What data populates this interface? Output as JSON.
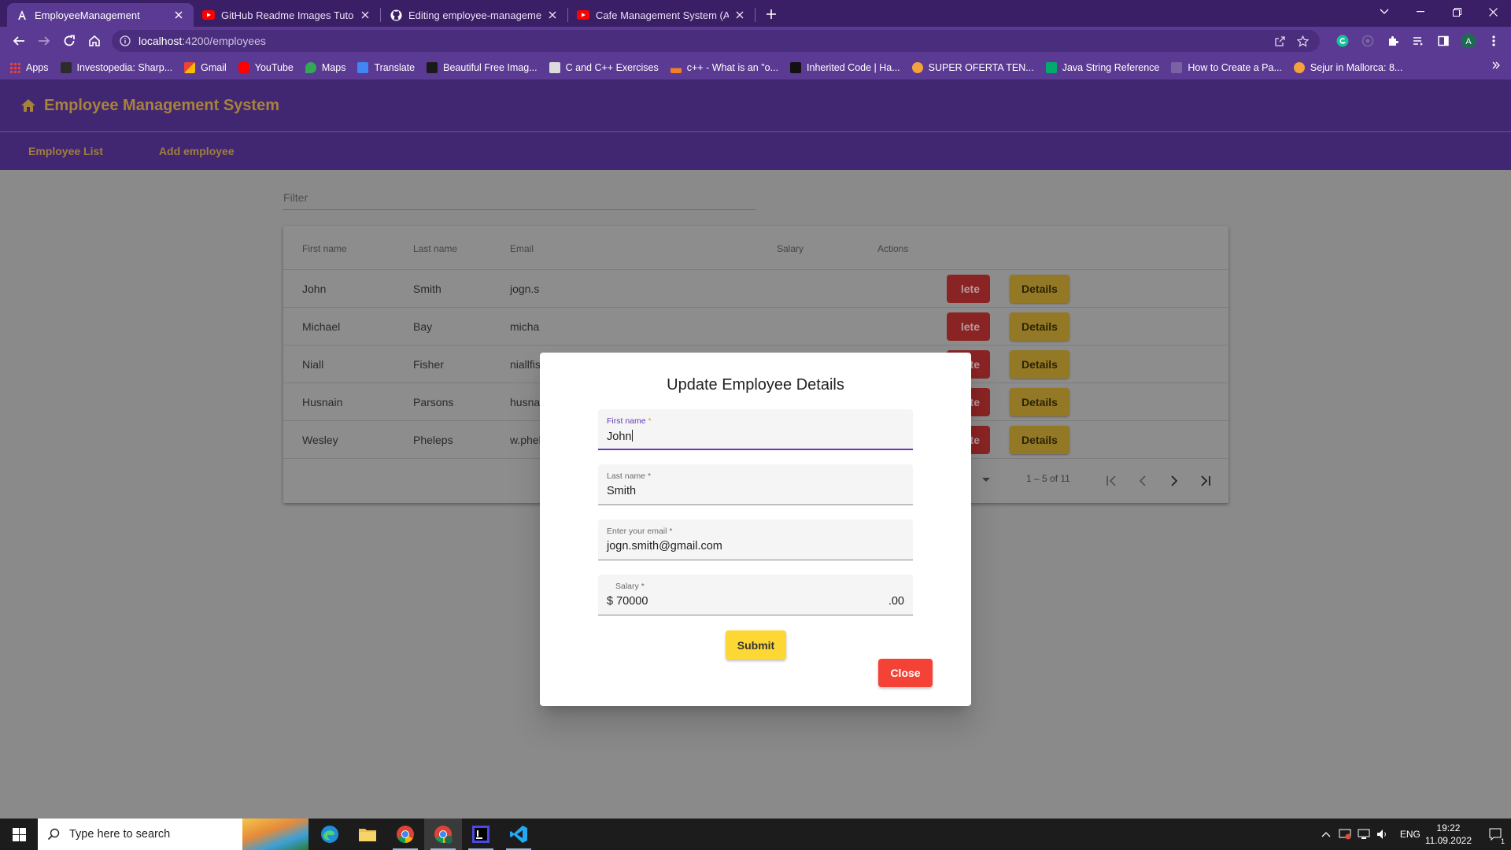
{
  "browser": {
    "tabs": [
      {
        "title": "EmployeeManagement",
        "favicon": "angular-icon",
        "active": true
      },
      {
        "title": "GitHub Readme Images Tutorial",
        "favicon": "youtube-icon",
        "active": false
      },
      {
        "title": "Editing employee-management-",
        "favicon": "github-icon",
        "active": false
      },
      {
        "title": "Cafe Management System (Angu",
        "favicon": "youtube-icon",
        "active": false
      }
    ],
    "url_host": "localhost",
    "url_path": ":4200/employees",
    "bookmarks": [
      {
        "label": "Apps",
        "icon": "apps-grid-icon"
      },
      {
        "label": "Investopedia: Sharp...",
        "icon": "investopedia-icon"
      },
      {
        "label": "Gmail",
        "icon": "gmail-icon"
      },
      {
        "label": "YouTube",
        "icon": "youtube-icon"
      },
      {
        "label": "Maps",
        "icon": "maps-icon"
      },
      {
        "label": "Translate",
        "icon": "translate-icon"
      },
      {
        "label": "Beautiful Free Imag...",
        "icon": "unsplash-icon"
      },
      {
        "label": "C and C++ Exercises",
        "icon": "exercises-icon"
      },
      {
        "label": "c++ - What is an \"o...",
        "icon": "stackoverflow-icon"
      },
      {
        "label": "Inherited Code | Ha...",
        "icon": "hackerrank-icon"
      },
      {
        "label": "SUPER OFERTA TEN...",
        "icon": "offer-icon"
      },
      {
        "label": "Java String Reference",
        "icon": "w3schools-icon"
      },
      {
        "label": "How to Create a Pa...",
        "icon": "page-icon"
      },
      {
        "label": "Sejur in Mallorca: 8...",
        "icon": "travel-icon"
      }
    ]
  },
  "app": {
    "title": "Employee Management System",
    "nav": [
      "Employee List",
      "Add employee"
    ],
    "filter_placeholder": "Filter",
    "table": {
      "headers": [
        "First name",
        "Last name",
        "Email",
        "Salary",
        "Actions"
      ],
      "rows": [
        {
          "first": "John",
          "last": "Smith",
          "email": "jogn.s"
        },
        {
          "first": "Michael",
          "last": "Bay",
          "email": "micha"
        },
        {
          "first": "Niall",
          "last": "Fisher",
          "email": "niallfis"
        },
        {
          "first": "Husnain",
          "last": "Parsons",
          "email": "husna"
        },
        {
          "first": "Wesley",
          "last": "Pheleps",
          "email": "w.phel"
        }
      ],
      "delete_label": "lete",
      "details_label": "Details"
    },
    "paginator": {
      "range": "1 – 5 of 11"
    }
  },
  "dialog": {
    "title": "Update Employee Details",
    "fields": {
      "first_name": {
        "label": "First name",
        "required": "*",
        "value": "John"
      },
      "last_name": {
        "label": "Last name",
        "required": "*",
        "value": "Smith"
      },
      "email": {
        "label": "Enter your email",
        "required": "*",
        "value": "jogn.smith@gmail.com"
      },
      "salary": {
        "label": "Salary",
        "required": "*",
        "prefix": "$",
        "value": "70000",
        "suffix": ".00"
      }
    },
    "submit_label": "Submit",
    "close_label": "Close"
  },
  "taskbar": {
    "search_placeholder": "Type here to search",
    "language": "ENG",
    "time": "19:22",
    "date": "11.09.2022",
    "notification_count": "1"
  },
  "colors": {
    "header_bg": "#412771",
    "accent_gold": "#a7823b",
    "submit_yellow": "#fdd835",
    "close_red": "#f44336",
    "focus_purple": "#673ab7"
  }
}
